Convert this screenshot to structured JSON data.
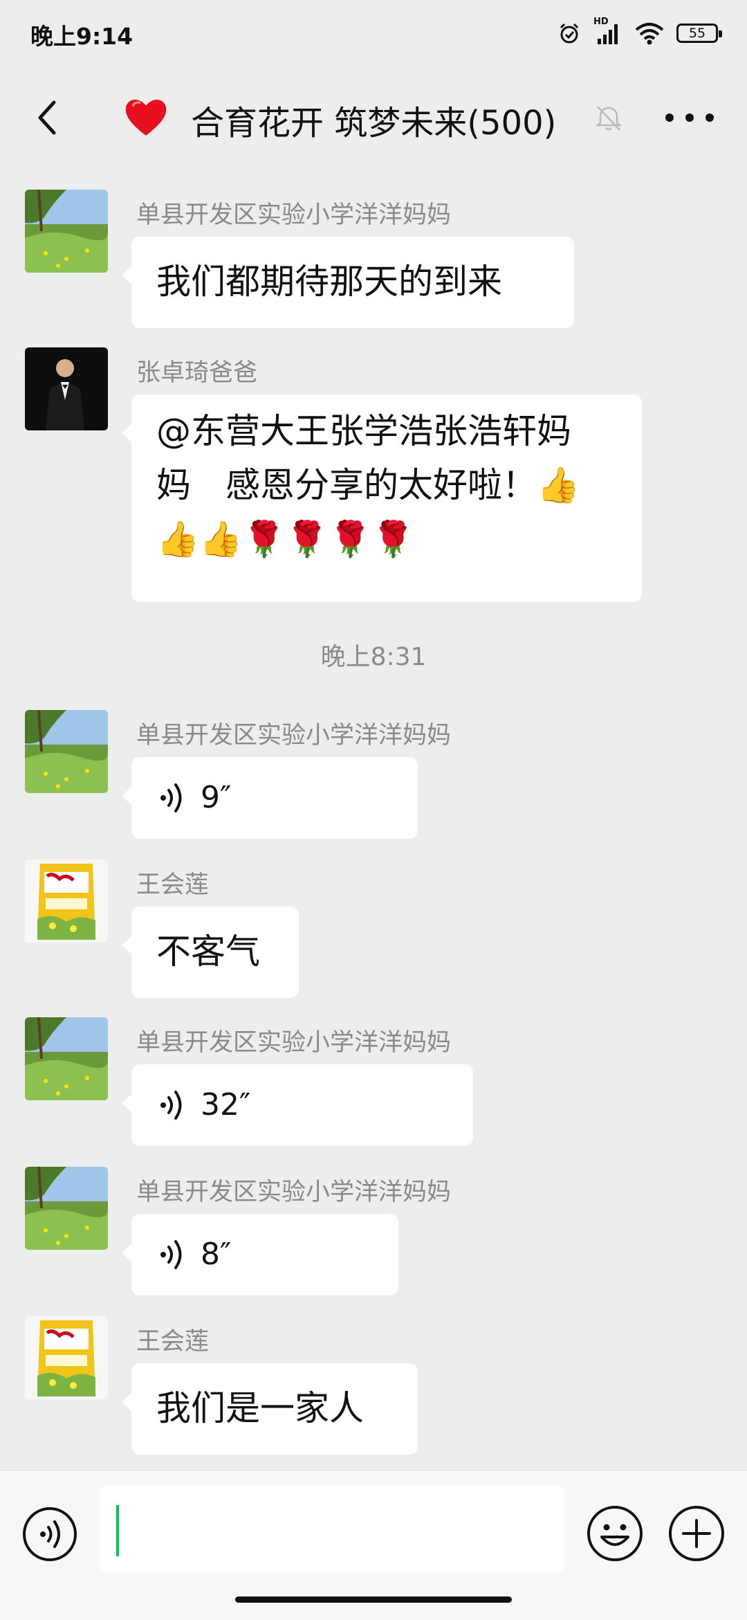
{
  "status_bar": {
    "time": "晚上9:14",
    "network": "HD",
    "battery": "55",
    "icons": [
      "alarm-icon",
      "signal-icon",
      "wifi-icon",
      "battery-icon"
    ]
  },
  "header": {
    "title": "合育花开 筑梦未来(500)",
    "icons": [
      "back-icon",
      "heart-icon",
      "mute-icon",
      "more-icon"
    ]
  },
  "messages": [
    {
      "sender": "单县开发区实验小学洋洋妈妈",
      "text": "我们都期待那天的到来",
      "avatar": "landscape"
    },
    {
      "sender": "张卓琦爸爸",
      "text_lines": [
        "@东营大王张学浩张浩轩妈",
        "妈　感恩分享的太好啦！👍",
        "👍👍🌹🌹🌹🌹"
      ],
      "avatar": "man-in-suit"
    },
    {
      "timestamp": "晚上8:31"
    },
    {
      "sender": "单县开发区实验小学洋洋妈妈",
      "voice_duration": "9″",
      "avatar": "landscape"
    },
    {
      "sender": "王会莲",
      "text": "不客气",
      "avatar": "product-bag"
    },
    {
      "sender": "单县开发区实验小学洋洋妈妈",
      "voice_duration": "32″",
      "avatar": "landscape"
    },
    {
      "sender": "单县开发区实验小学洋洋妈妈",
      "voice_duration": "8″",
      "avatar": "landscape"
    },
    {
      "sender": "王会莲",
      "text": "我们是一家人",
      "avatar": "product-bag"
    }
  ],
  "input_bar": {
    "value": "",
    "icons": [
      "voice-input-icon",
      "emoji-icon",
      "plus-icon"
    ]
  },
  "colors": {
    "background": "#ededed",
    "bubble": "#ffffff",
    "sender_text": "#8a8a8a",
    "cursor": "#07c160",
    "heart": "#e8101f"
  }
}
